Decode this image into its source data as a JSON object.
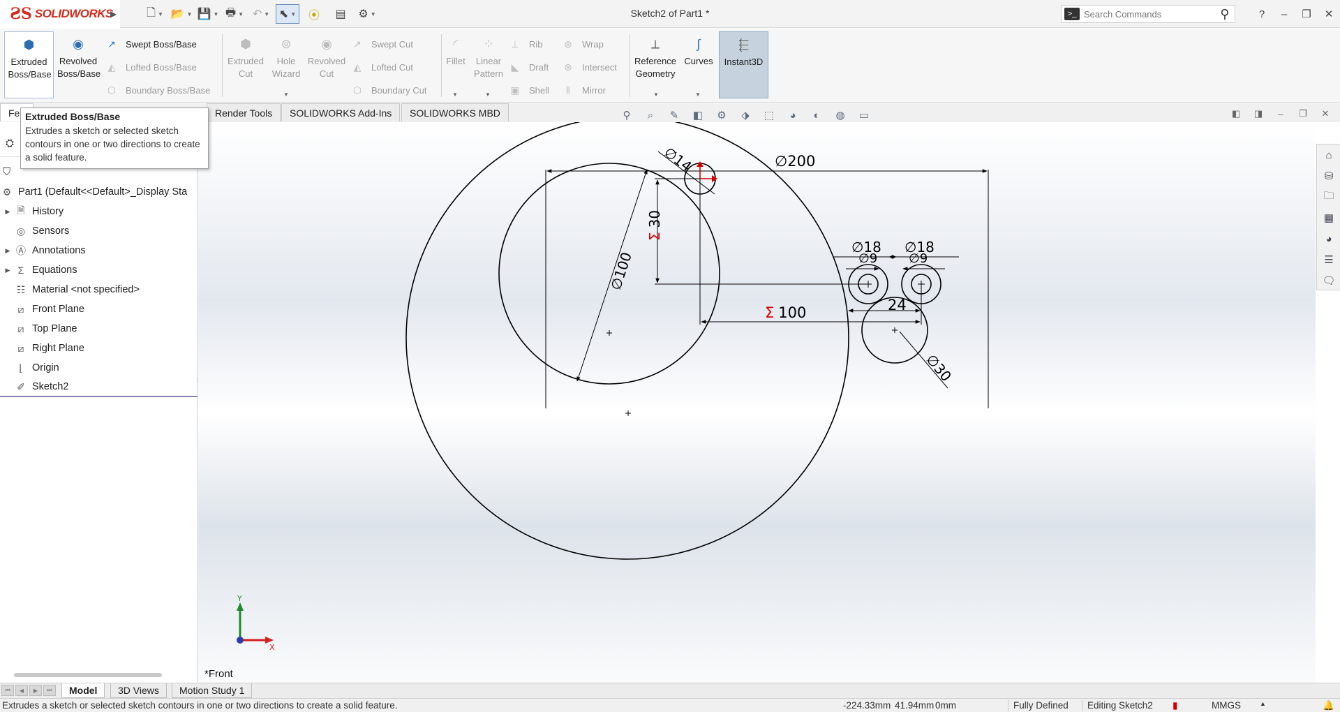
{
  "app": {
    "brand": "SOLIDWORKS",
    "title": "Sketch2 of Part1 *"
  },
  "quick_access": [
    {
      "name": "new-document",
      "icon": "new-file-icon"
    },
    {
      "name": "open",
      "icon": "open-folder-icon"
    },
    {
      "name": "save",
      "icon": "save-icon"
    },
    {
      "name": "print",
      "icon": "print-icon"
    },
    {
      "name": "undo",
      "icon": "undo-icon"
    },
    {
      "name": "select",
      "icon": "cursor-icon"
    },
    {
      "name": "rebuild",
      "icon": "traffic-light-icon"
    },
    {
      "name": "file-properties",
      "icon": "properties-icon"
    },
    {
      "name": "options",
      "icon": "gear-icon"
    }
  ],
  "search": {
    "placeholder": "Search Commands"
  },
  "ribbon": {
    "extruded_boss": "Extruded Boss/Base",
    "revolved_boss": "Revolved Boss/Base",
    "swept_boss": "Swept Boss/Base",
    "lofted_boss": "Lofted Boss/Base",
    "boundary_boss": "Boundary Boss/Base",
    "extruded_cut": "Extruded Cut",
    "hole_wizard": "Hole Wizard",
    "revolved_cut": "Revolved Cut",
    "swept_cut": "Swept Cut",
    "lofted_cut": "Lofted Cut",
    "boundary_cut": "Boundary Cut",
    "fillet": "Fillet",
    "linear_pattern": "Linear Pattern",
    "rib": "Rib",
    "draft": "Draft",
    "shell": "Shell",
    "wrap": "Wrap",
    "intersect": "Intersect",
    "mirror": "Mirror",
    "reference_geometry": "Reference Geometry",
    "curves": "Curves",
    "instant3d": "Instant3D"
  },
  "command_tabs": {
    "features": "Fea",
    "render_tools": "Render Tools",
    "addins": "SOLIDWORKS Add-Ins",
    "mbd": "SOLIDWORKS MBD"
  },
  "tooltip": {
    "title": "Extruded Boss/Base",
    "body": "Extrudes a sketch or selected sketch contours in one or two directions to create a solid feature."
  },
  "tree": {
    "root": "Part1  (Default<<Default>_Display Sta",
    "items": [
      {
        "label": "History",
        "expandable": true,
        "icon": "history-icon"
      },
      {
        "label": "Sensors",
        "expandable": false,
        "icon": "sensor-icon"
      },
      {
        "label": "Annotations",
        "expandable": true,
        "icon": "annotations-icon"
      },
      {
        "label": "Equations",
        "expandable": true,
        "icon": "equations-icon"
      },
      {
        "label": "Material <not specified>",
        "expandable": false,
        "icon": "material-icon"
      },
      {
        "label": "Front Plane",
        "expandable": false,
        "icon": "plane-icon"
      },
      {
        "label": "Top Plane",
        "expandable": false,
        "icon": "plane-icon"
      },
      {
        "label": "Right Plane",
        "expandable": false,
        "icon": "plane-icon"
      },
      {
        "label": "Origin",
        "expandable": false,
        "icon": "origin-icon"
      },
      {
        "label": "Sketch2",
        "expandable": false,
        "icon": "sketch-icon"
      }
    ]
  },
  "sketch": {
    "dimensions": {
      "outer_dia": "200",
      "small_top_dia": "14",
      "inner_dia": "100",
      "vertical_30": "30",
      "horizontal_100": "100",
      "right_dia_18a": "18",
      "right_dia_9a": "9",
      "right_dia_18b": "18",
      "right_dia_9b": "9",
      "spacing_24": "24",
      "lower_dia_30": "30"
    },
    "dia_symbol": "∅",
    "sigma_symbol": "Σ",
    "colors": {
      "line": "#000000",
      "driven": "#d40000",
      "origin_axis": "#d40000"
    }
  },
  "view": {
    "orientation_label": "*Front",
    "triad_x": "X",
    "triad_y": "Y"
  },
  "bottom_tabs": [
    "Model",
    "3D Views",
    "Motion Study 1"
  ],
  "status": {
    "message": "Extrudes a sketch or selected sketch contours in one or two directions to create a solid feature.",
    "x": "-224.33mm",
    "y": "41.94mm",
    "z": "0mm",
    "definition": "Fully Defined",
    "mode": "Editing Sketch2",
    "units": "MMGS"
  },
  "accent_colors": {
    "brand_red": "#d52b1e",
    "selection_blue": "#a8bdd6"
  }
}
